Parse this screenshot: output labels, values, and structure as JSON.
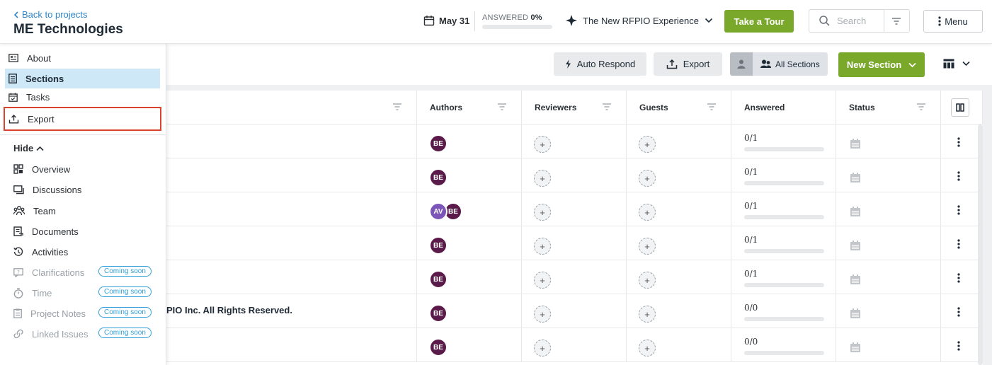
{
  "header": {
    "back_label": "Back to projects",
    "project_title": "ME Technologies",
    "due_date": "May 31",
    "answered_label": "ANSWERED",
    "answered_percent": "0%",
    "answered_fraction": 0,
    "experience_label": "The New RFPIO Experience",
    "tour_label": "Take a Tour",
    "search_placeholder": "Search",
    "menu_label": "Menu"
  },
  "sidebar": {
    "items": [
      {
        "label": "About",
        "icon": "about-icon"
      },
      {
        "label": "Sections",
        "icon": "sections-icon"
      },
      {
        "label": "Tasks",
        "icon": "tasks-icon"
      },
      {
        "label": "Export",
        "icon": "export-icon"
      }
    ],
    "hide_label": "Hide",
    "sub_items": [
      {
        "label": "Overview",
        "icon": "overview-icon"
      },
      {
        "label": "Discussions",
        "icon": "discussions-icon"
      },
      {
        "label": "Team",
        "icon": "team-icon"
      },
      {
        "label": "Documents",
        "icon": "documents-icon"
      },
      {
        "label": "Activities",
        "icon": "activities-icon"
      },
      {
        "label": "Clarifications",
        "icon": "clarifications-icon",
        "badge": "Coming soon"
      },
      {
        "label": "Time",
        "icon": "time-icon",
        "badge": "Coming soon"
      },
      {
        "label": "Project Notes",
        "icon": "notes-icon",
        "badge": "Coming soon"
      },
      {
        "label": "Linked Issues",
        "icon": "linked-issues-icon",
        "badge": "Coming soon"
      }
    ]
  },
  "toolbar": {
    "auto_respond_label": "Auto Respond",
    "export_label": "Export",
    "all_sections_label": "All Sections",
    "new_section_label": "New Section"
  },
  "table": {
    "columns": [
      "Authors",
      "Reviewers",
      "Guests",
      "Answered",
      "Status"
    ],
    "rows": [
      {
        "text": "",
        "authors": [
          "BE"
        ],
        "answered": "0/1"
      },
      {
        "text": "",
        "authors": [
          "BE"
        ],
        "answered": "0/1"
      },
      {
        "text": "",
        "authors": [
          "AV",
          "BE"
        ],
        "answered": "0/1"
      },
      {
        "text": "",
        "authors": [
          "BE"
        ],
        "answered": "0/1"
      },
      {
        "text": "",
        "authors": [
          "BE"
        ],
        "answered": "0/1"
      },
      {
        "text": "PIO Inc. All Rights Reserved.",
        "authors": [
          "BE"
        ],
        "answered": "0/0"
      },
      {
        "text": "",
        "authors": [
          "BE"
        ],
        "answered": "0/0"
      }
    ]
  },
  "colors": {
    "accent_green": "#7aa82a",
    "link_blue": "#2f86c9",
    "active_bg": "#cfe8f8",
    "highlight_red": "#d9432e",
    "avatar_purple": "#5a1a4a"
  }
}
